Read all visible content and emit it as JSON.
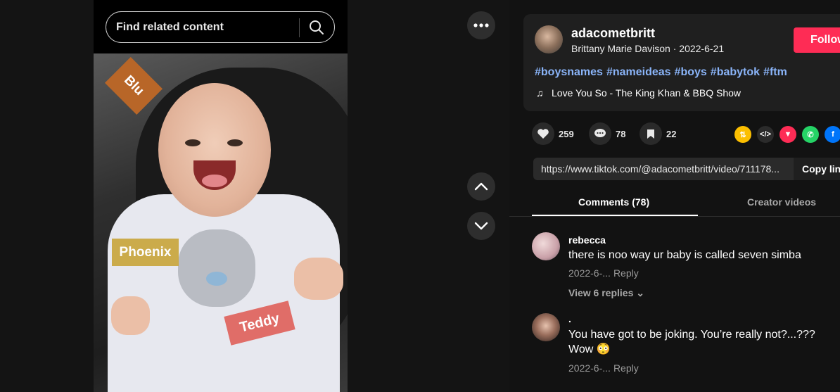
{
  "search": {
    "placeholder": "Find related content"
  },
  "video": {
    "tags": {
      "blu": "Blu",
      "phoenix": "Phoenix",
      "teddy": "Teddy"
    }
  },
  "controls": {
    "more": "more-icon",
    "up": "chevron-up-icon",
    "down": "chevron-down-icon"
  },
  "post": {
    "username": "adacometbritt",
    "display_name": "Brittany Marie Davison",
    "separator": " · ",
    "date": "2022-6-21",
    "follow_label": "Follow",
    "hashtags": [
      "#boysnames",
      "#nameideas",
      "#boys",
      "#babytok",
      "#ftm"
    ],
    "music": "Love You So - The King Khan & BBQ Show"
  },
  "stats": {
    "likes": "259",
    "comments": "78",
    "saves": "22"
  },
  "share": {
    "colors": {
      "repost": "#fcbf00",
      "embed": "#2b2b2b",
      "send": "#fe2c55",
      "whatsapp": "#25d366",
      "facebook": "#0075fa"
    }
  },
  "link": {
    "url": "https://www.tiktok.com/@adacometbritt/video/711178...",
    "copy_label": "Copy link"
  },
  "tabs": {
    "comments": "Comments (78)",
    "creator": "Creator videos"
  },
  "comments": [
    {
      "user": "rebecca",
      "text": "there is noo way ur baby is called seven simba",
      "date": "2022-6-...",
      "reply": "Reply",
      "replies": "View 6 replies"
    },
    {
      "user": ".",
      "text": "You have got to be joking. You’re really not?...??? Wow 😳",
      "date": "2022-6-...",
      "reply": "Reply"
    }
  ]
}
